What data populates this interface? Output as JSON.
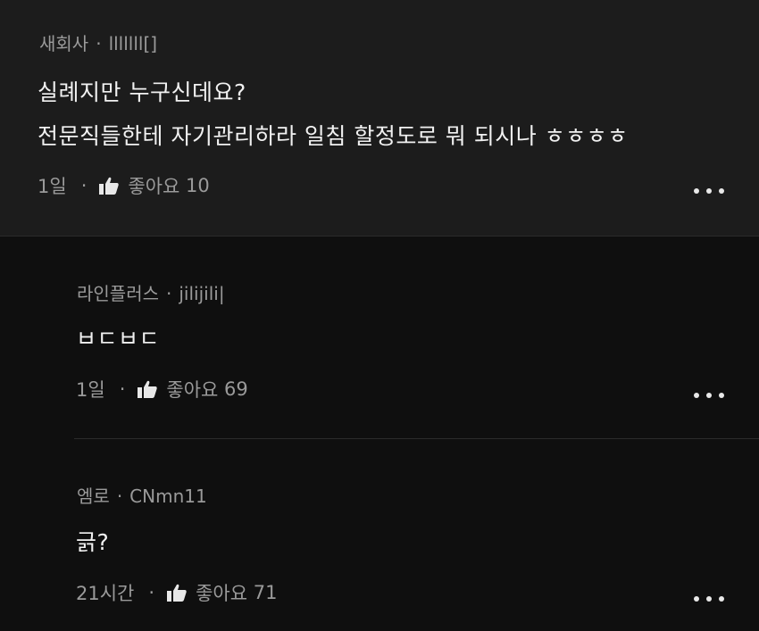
{
  "comments": [
    {
      "author": "새회사",
      "separator": "·",
      "company": "lllllll[]",
      "lines": [
        "실례지만 누구신데요?",
        "전문직들한테 자기관리하라 일침 할정도로 뭐 되시나 ㅎㅎㅎㅎ"
      ],
      "time": "1일",
      "like_label": "좋아요",
      "like_count": "10"
    },
    {
      "author": "라인플러스",
      "separator": "·",
      "company": "jilijili|",
      "lines": [
        "ㅂㄷㅂㄷ"
      ],
      "time": "1일",
      "like_label": "좋아요",
      "like_count": "69"
    },
    {
      "author": "엠로",
      "separator": "·",
      "company": "CNmn11",
      "lines": [
        "긁?"
      ],
      "time": "21시간",
      "like_label": "좋아요",
      "like_count": "71"
    }
  ],
  "icons": {
    "like": "thumbs-up-icon",
    "more": "more-horizontal-icon"
  },
  "colors": {
    "top_comment_bg": "#1c1c1c",
    "page_bg": "#0f0f0f",
    "meta_text": "#9a9a9a",
    "body_text": "#f1f1f1"
  }
}
